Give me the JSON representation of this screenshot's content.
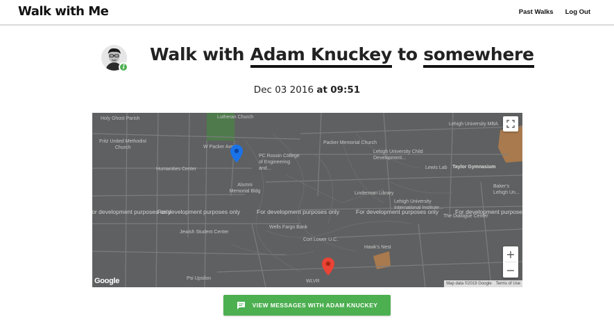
{
  "header": {
    "brand": "Walk with Me",
    "nav": [
      "Past Walks",
      "Log Out"
    ]
  },
  "walk": {
    "title_prefix": "Walk with",
    "partner": "Adam Knuckey",
    "title_mid": "to",
    "destination": "somewhere",
    "date": "Dec 03 2016",
    "at": "at",
    "time": "09:51"
  },
  "map": {
    "labels": {
      "holy_ghost": "Holy Ghost Parish",
      "fritz": "Fritz United Methodist Church",
      "lutheran": "Lutheran Church",
      "w_packer": "W Packer Ave",
      "humanities": "Humanities Center",
      "rossin": "PC Rossin College of Engineering and...",
      "alumni": "Alumni Memorial Bldg",
      "packer_memorial": "Packer Memorial Church",
      "child_dev": "Lehigh University Child Development...",
      "lewis": "Lewis Lab",
      "taylor": "Taylor Gymnasium",
      "mba": "Lehigh University MBA",
      "linderman": "Linderman Library",
      "intl": "Lehigh University International Institute...",
      "dialogue": "The Dialogue Center",
      "bakers": "Baker's Lehigh Un...",
      "wells": "Wells Fargo Bank",
      "cort": "Cort Lower U.C.",
      "jewish": "Jewish Student Center",
      "hawks": "Hawk's Nest",
      "wlvr": "WLVR",
      "psi": "Psi Upsilon"
    },
    "dev_watermark": "For development purposes only",
    "google": "Google",
    "attribution": "Map data ©2019 Google",
    "terms": "Terms of Use",
    "zoom_in": "+",
    "zoom_out": "−"
  },
  "actions": {
    "view_messages": "VIEW MESSAGES WITH ADAM KNUCKEY"
  },
  "colors": {
    "accent_green": "#4caf50",
    "map_bg": "#5f6061",
    "pin_blue": "#1a73e8",
    "pin_red": "#ea4335"
  },
  "icons": {
    "message": "message-icon",
    "fullscreen": "fullscreen-icon",
    "start_pin": "blue-map-pin-icon",
    "end_pin": "red-map-pin-icon"
  }
}
